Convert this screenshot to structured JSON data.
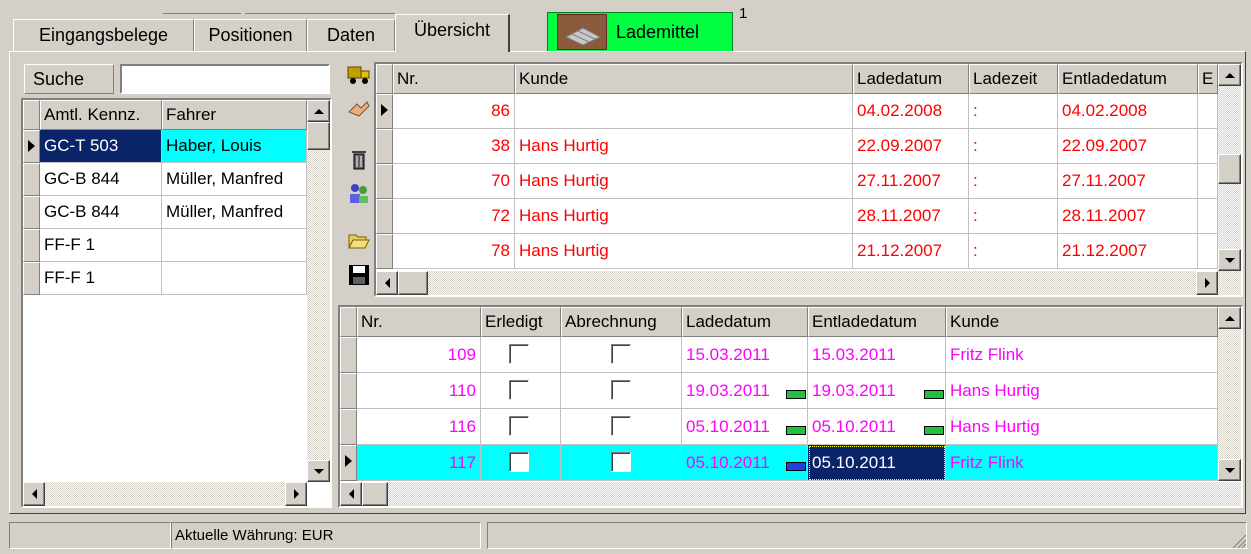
{
  "tabs": [
    {
      "label": "Eingangsbelege",
      "active": false
    },
    {
      "label": "Positionen",
      "active": false
    },
    {
      "label": "Daten",
      "active": false
    },
    {
      "label": "Übersicht",
      "active": true
    }
  ],
  "lademittel": {
    "label": "Lademittel",
    "badge": "1",
    "color": "#00ff40"
  },
  "search": {
    "label": "Suche",
    "value": ""
  },
  "vehicles": {
    "columns": [
      "Amtl. Kennz.",
      "Fahrer"
    ],
    "rows": [
      {
        "kennz": "GC-T 503",
        "fahrer": "Haber, Louis",
        "selected": true
      },
      {
        "kennz": "GC-B 844",
        "fahrer": "Müller, Manfred",
        "selected": false
      },
      {
        "kennz": "GC-B 844",
        "fahrer": "Müller, Manfred",
        "selected": false
      },
      {
        "kennz": "FF-F 1",
        "fahrer": "",
        "selected": false
      },
      {
        "kennz": "FF-F 1",
        "fahrer": "",
        "selected": false
      }
    ]
  },
  "toolbar_icons": [
    "truck-icon",
    "handshake-icon",
    "trash-icon",
    "people-icon",
    "open-folder-icon",
    "save-icon"
  ],
  "top_grid": {
    "columns": [
      "Nr.",
      "Kunde",
      "Ladedatum",
      "Ladezeit",
      "Entladedatum",
      "E"
    ],
    "rows": [
      {
        "nr": "86",
        "kunde": "",
        "ladedatum": "04.02.2008",
        "ladezeit": ":",
        "entladedatum": "04.02.2008"
      },
      {
        "nr": "38",
        "kunde": "Hans Hurtig",
        "ladedatum": "22.09.2007",
        "ladezeit": ":",
        "entladedatum": "22.09.2007"
      },
      {
        "nr": "70",
        "kunde": "Hans Hurtig",
        "ladedatum": "27.11.2007",
        "ladezeit": ":",
        "entladedatum": "27.11.2007"
      },
      {
        "nr": "72",
        "kunde": "Hans Hurtig",
        "ladedatum": "28.11.2007",
        "ladezeit": ":",
        "entladedatum": "28.11.2007"
      },
      {
        "nr": "78",
        "kunde": "Hans Hurtig",
        "ladedatum": "21.12.2007",
        "ladezeit": ":",
        "entladedatum": "21.12.2007"
      }
    ]
  },
  "bottom_grid": {
    "columns": [
      "Nr.",
      "Erledigt",
      "Abrechnung",
      "Ladedatum",
      "Entladedatum",
      "Kunde"
    ],
    "rows": [
      {
        "nr": "109",
        "erledigt": false,
        "abrechnung": false,
        "ladedatum": "15.03.2011",
        "entladedatum": "15.03.2011",
        "kunde": "Fritz Flink",
        "selected": false
      },
      {
        "nr": "110",
        "erledigt": false,
        "abrechnung": false,
        "ladedatum": "19.03.2011",
        "entladedatum": "19.03.2011",
        "kunde": "Hans Hurtig",
        "selected": false
      },
      {
        "nr": "116",
        "erledigt": false,
        "abrechnung": false,
        "ladedatum": "05.10.2011",
        "entladedatum": "05.10.2011",
        "kunde": "Hans Hurtig",
        "selected": false
      },
      {
        "nr": "117",
        "erledigt": false,
        "abrechnung": false,
        "ladedatum": "05.10.2011",
        "entladedatum": "05.10.2011",
        "kunde": "Fritz Flink",
        "selected": true
      }
    ]
  },
  "status": {
    "currency": "Aktuelle Währung: EUR"
  },
  "colors": {
    "selection": "#00ffff",
    "focus": "#0a246a",
    "red_text": "#ff0000",
    "magenta_text": "#ff00ff"
  }
}
